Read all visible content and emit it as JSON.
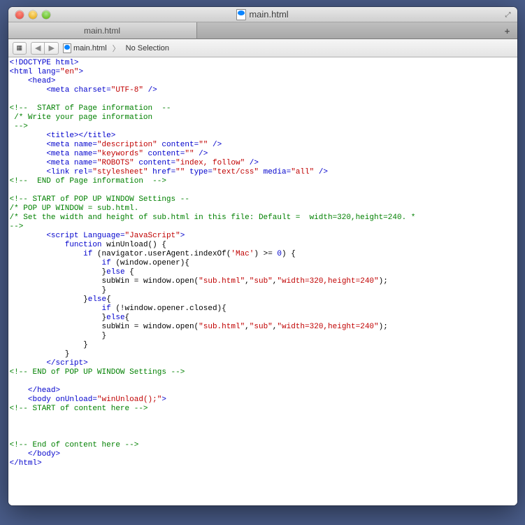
{
  "window": {
    "title": "main.html"
  },
  "tab": {
    "label": "main.html"
  },
  "breadcrumb": {
    "file": "main.html",
    "selection": "No Selection"
  },
  "code": {
    "l1": {
      "a": "<!DOCTYPE html>"
    },
    "l2": {
      "a": "<html",
      "b": " lang=",
      "c": "\"en\"",
      "d": ">"
    },
    "l3": {
      "a": "<head>"
    },
    "l4": {
      "a": "<meta",
      "b": " charset=",
      "c": "\"UTF-8\"",
      "d": " />"
    },
    "l5": {
      "a": "<!--  START of Page information  --"
    },
    "l6": {
      "a": " /* Write your page information"
    },
    "l7": {
      "a": " -->"
    },
    "l8": {
      "a": "<title>",
      "b": "</title>"
    },
    "l9": {
      "a": "<meta",
      "b": " name=",
      "c": "\"description\"",
      "d": " content=",
      "e": "\"\"",
      "f": " />"
    },
    "l10": {
      "a": "<meta",
      "b": " name=",
      "c": "\"keywords\"",
      "d": " content=",
      "e": "\"\"",
      "f": " />"
    },
    "l11": {
      "a": "<meta",
      "b": " name=",
      "c": "\"ROBOTS\"",
      "d": " content=",
      "e": "\"index, follow\"",
      "f": " />"
    },
    "l12": {
      "a": "<link",
      "b": " rel=",
      "c": "\"stylesheet\"",
      "d": " href=",
      "e": "\"\"",
      "f": " type=",
      "g": "\"text/css\"",
      "h": " media=",
      "i": "\"all\"",
      "j": " />"
    },
    "l13": {
      "a": "<!--  END of Page information  -->"
    },
    "l14": {
      "a": "<!-- START of POP UP WINDOW Settings --"
    },
    "l15": {
      "a": "/* POP UP WINDOW = sub.html."
    },
    "l16": {
      "a": "/* Set the width and height of sub.html in this file: Default =  width=320,height=240. *"
    },
    "l17": {
      "a": "-->"
    },
    "l18": {
      "a": "<script",
      "b": " Language=",
      "c": "\"JavaScript\"",
      "d": ">"
    },
    "l19": {
      "a": "function",
      "b": " winUnload() {"
    },
    "l20": {
      "a": "if",
      "b": " (navigator.userAgent.indexOf(",
      "c": "'Mac'",
      "d": ") >= ",
      "e": "0",
      "f": ") {"
    },
    "l21": {
      "a": "if",
      "b": " (window.opener){"
    },
    "l22": {
      "a": "}",
      "b": "else",
      "c": " {"
    },
    "l23": {
      "a": "subWin = window.open(",
      "b": "\"sub.html\"",
      "c": ",",
      "d": "\"sub\"",
      "e": ",",
      "f": "\"width=320,height=240\"",
      "g": ");"
    },
    "l24": {
      "a": "}"
    },
    "l25": {
      "a": "}",
      "b": "else",
      "c": "{"
    },
    "l26": {
      "a": "if",
      "b": " (!window.opener.closed){"
    },
    "l27": {
      "a": "}",
      "b": "else",
      "c": "{"
    },
    "l28": {
      "a": "subWin = window.open(",
      "b": "\"sub.html\"",
      "c": ",",
      "d": "\"sub\"",
      "e": ",",
      "f": "\"width=320,height=240\"",
      "g": ");"
    },
    "l29": {
      "a": "}"
    },
    "l30": {
      "a": "}"
    },
    "l31": {
      "a": "}"
    },
    "l32": {
      "a": "</",
      "b": "script",
      "c": ">"
    },
    "l33": {
      "a": "<!-- END of POP UP WINDOW Settings -->"
    },
    "l34": {
      "a": "</head>"
    },
    "l35": {
      "a": "<body",
      "b": " onUnload=",
      "c": "\"winUnload();\"",
      "d": ">"
    },
    "l36": {
      "a": "<!-- START of content here -->"
    },
    "l37": {
      "a": "<!-- End of content here -->"
    },
    "l38": {
      "a": "</body>"
    },
    "l39": {
      "a": "</html>"
    }
  }
}
